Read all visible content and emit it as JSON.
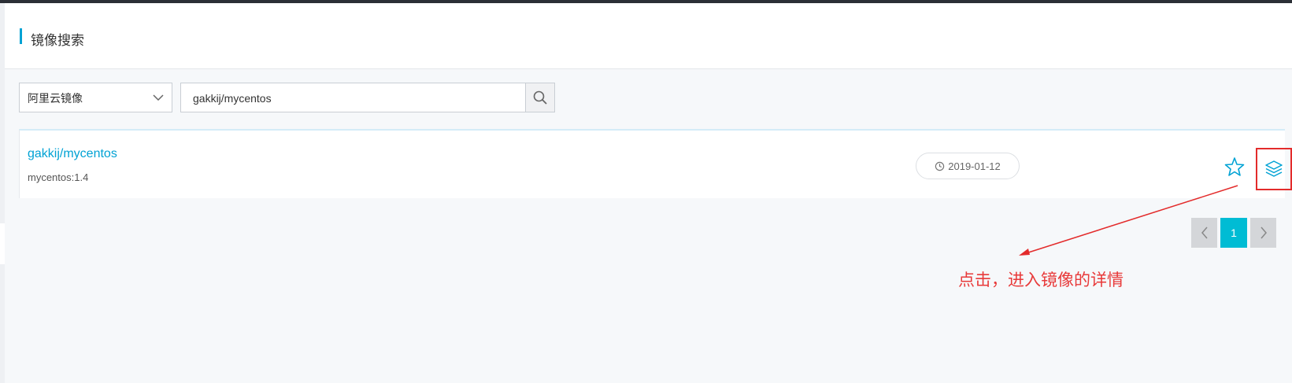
{
  "header": {
    "title": "镜像搜索"
  },
  "filter": {
    "registry_selected": "阿里云镜像",
    "search_value": "gakkij/mycentos"
  },
  "results": [
    {
      "name": "gakkij/mycentos",
      "tag": "mycentos:1.4",
      "date": "2019-01-12"
    }
  ],
  "pagination": {
    "current_page": "1"
  },
  "annotation": {
    "text": "点击，进入镜像的详情"
  },
  "colors": {
    "accent": "#00a2d4",
    "page_active": "#00bcd4",
    "annotation": "#e83a3a",
    "highlight_box": "#e32b2b"
  },
  "icons": [
    "chevron-down-icon",
    "search-icon",
    "clock-icon",
    "star-icon",
    "layers-icon",
    "chevron-left-icon",
    "chevron-right-icon"
  ]
}
